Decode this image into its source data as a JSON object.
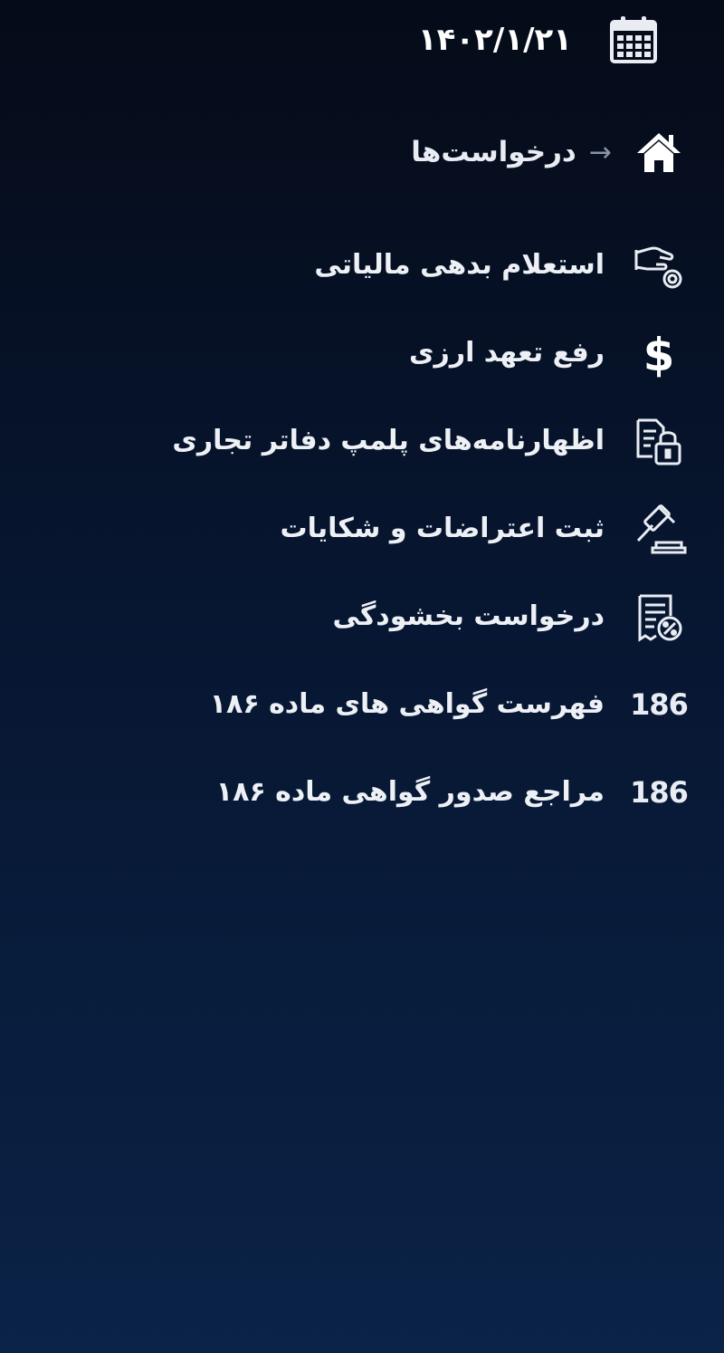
{
  "header": {
    "date": "۱۴۰۲/۱/۲۱",
    "calendar_icon": "calendar-icon"
  },
  "breadcrumb": {
    "label": "درخواست‌ها",
    "home_icon": "home-icon",
    "arrow": "→"
  },
  "menu": {
    "items": [
      {
        "label": "استعلام بدهی مالیاتی",
        "icon": "hand-coin-icon"
      },
      {
        "label": "رفع تعهد ارزی",
        "icon": "dollar-icon"
      },
      {
        "label": "اظهارنامه‌های پلمپ دفاتر تجاری",
        "icon": "document-lock-icon"
      },
      {
        "label": "ثبت اعتراضات و شکایات",
        "icon": "gavel-icon"
      },
      {
        "label": "درخواست بخشودگی",
        "icon": "receipt-percent-icon"
      },
      {
        "label": "فهرست گواهی های ماده ۱۸۶",
        "icon": "number-186-icon",
        "icon_text": "186"
      },
      {
        "label": "مراجع صدور گواهی ماده ۱۸۶",
        "icon": "number-186-icon",
        "icon_text": "186"
      }
    ]
  }
}
